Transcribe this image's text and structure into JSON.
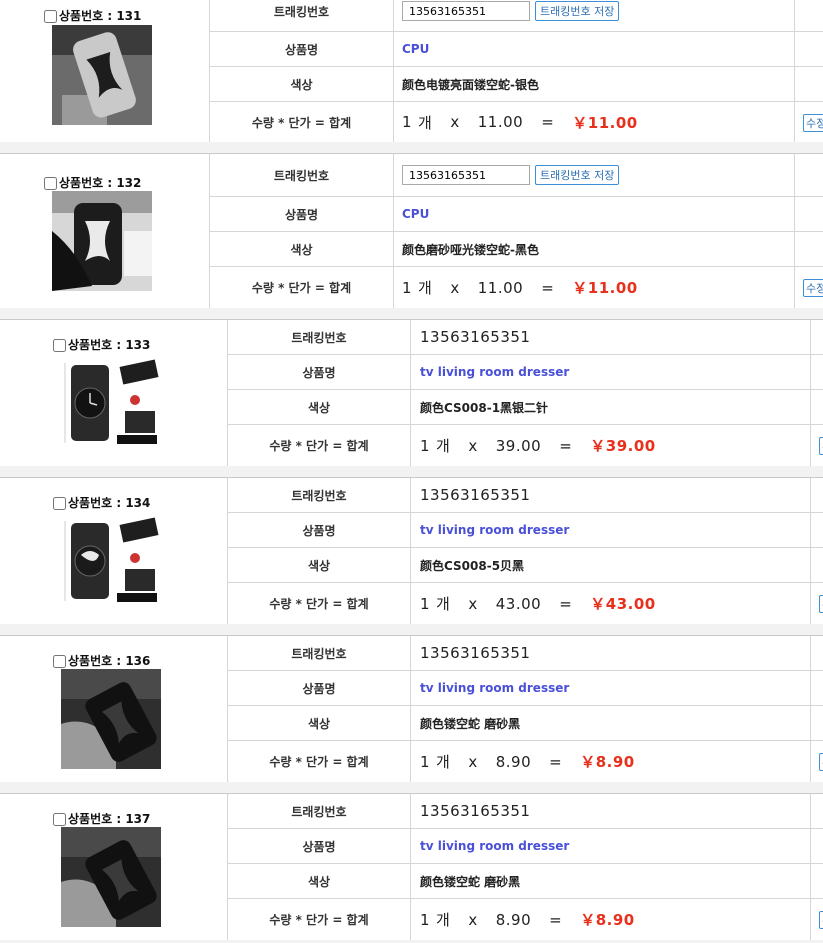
{
  "labels": {
    "product_no": "상품번호 :",
    "tracking": "트래킹번호",
    "product_name": "상품명",
    "color": "색상",
    "qty_price_total": "수량 * 단가 = 합계",
    "save_tracking": "트래킹번호 저장",
    "edit": "수정",
    "qty_unit": "개",
    "times": "x",
    "equals": "="
  },
  "items": [
    {
      "no": "131",
      "tracking": "13563165351",
      "name": "CPU",
      "color": "颜色电镀亮面镂空蛇-银色",
      "qty": "1",
      "price": "11.00",
      "total": "￥11.00",
      "image": "phone-case-silver"
    },
    {
      "no": "132",
      "tracking": "13563165351",
      "name": "CPU",
      "color": "颜色磨砂哑光镂空蛇-黑色",
      "qty": "1",
      "price": "11.00",
      "total": "￥11.00",
      "image": "phone-case-black-hand"
    },
    {
      "no": "133",
      "tracking": "13563165351",
      "name": "tv living room dresser",
      "color": "颜色CS008-1黑银二针",
      "qty": "1",
      "price": "39.00",
      "total": "￥39.00",
      "image": "watch-black-silver"
    },
    {
      "no": "134",
      "tracking": "13563165351",
      "name": "tv living room dresser",
      "color": "颜色CS008-5贝黑",
      "qty": "1",
      "price": "43.00",
      "total": "￥43.00",
      "image": "watch-black-shell"
    },
    {
      "no": "136",
      "tracking": "13563165351",
      "name": "tv living room dresser",
      "color": "颜色镂空蛇 磨砂黑",
      "qty": "1",
      "price": "8.90",
      "total": "￥8.90",
      "image": "phone-case-matte-black"
    },
    {
      "no": "137",
      "tracking": "13563165351",
      "name": "tv living room dresser",
      "color": "颜色镂空蛇 磨砂黑",
      "qty": "1",
      "price": "8.90",
      "total": "￥8.90",
      "image": "phone-case-matte-black"
    }
  ]
}
